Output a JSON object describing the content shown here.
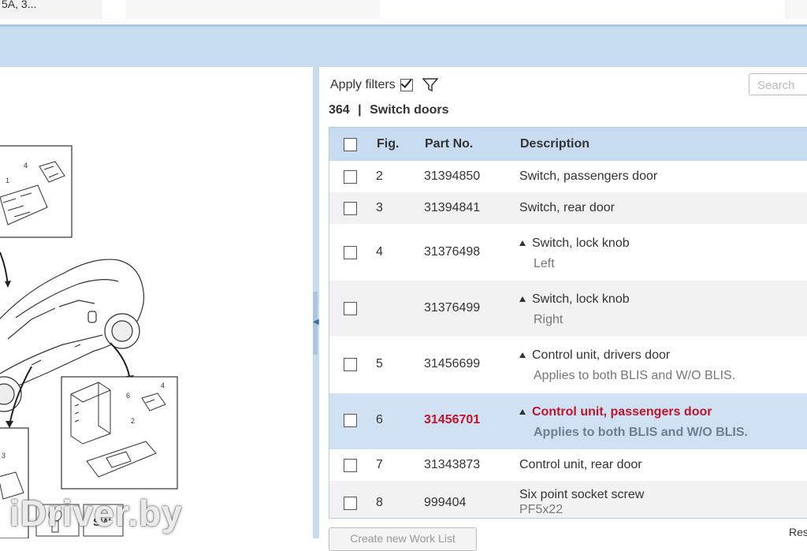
{
  "topbar": {
    "crumb": "5A, 3..."
  },
  "filters": {
    "apply_label": "Apply filters",
    "search_placeholder": "Search"
  },
  "group": {
    "number": "364",
    "separator": "|",
    "title": "Switch doors"
  },
  "table": {
    "columns": {
      "fig": "Fig.",
      "part": "Part No.",
      "desc": "Description"
    },
    "rows": [
      {
        "fig": "2",
        "part": "31394850",
        "desc": "Switch, passengers door",
        "sub": ""
      },
      {
        "fig": "3",
        "part": "31394841",
        "desc": "Switch, rear door",
        "sub": ""
      },
      {
        "fig": "4",
        "part": "31376498",
        "desc": "Switch, lock knob",
        "sub": "Left"
      },
      {
        "fig": "",
        "part": "31376499",
        "desc": "Switch, lock knob",
        "sub": "Right"
      },
      {
        "fig": "5",
        "part": "31456699",
        "desc": "Control unit, drivers door",
        "sub": "Applies to both BLIS and W/O BLIS."
      },
      {
        "fig": "6",
        "part": "31456701",
        "desc": "Control unit, passengers door",
        "sub": "Applies to both BLIS and W/O BLIS."
      },
      {
        "fig": "7",
        "part": "31343873",
        "desc": "Control unit, rear door",
        "sub": ""
      },
      {
        "fig": "8",
        "part": "999404",
        "desc": "Six point socket screw",
        "sub": "PF5x22"
      }
    ]
  },
  "footer": {
    "worklist_button": "Create new Work List",
    "right_text": "Res"
  },
  "diagram": {
    "callouts": [
      "4",
      "1",
      "6",
      "4",
      "2",
      "3"
    ],
    "swatch_label": "SW"
  },
  "watermark": "iDriver.by",
  "colors": {
    "header_bg": "#c7dcf0",
    "selected_row": "#cfe1f3",
    "selected_text": "#c0142b",
    "band": "#c8dcef"
  }
}
